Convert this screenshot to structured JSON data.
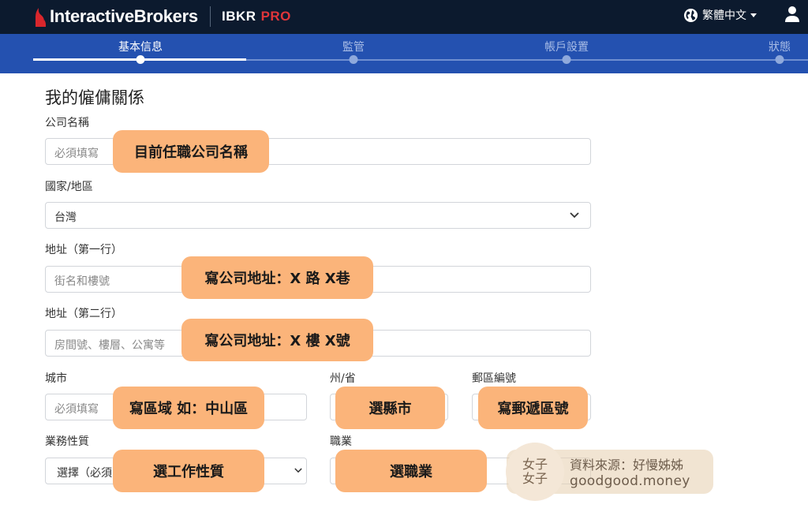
{
  "header": {
    "brand": "InteractiveBrokers",
    "product": "IBKR",
    "product_tag": "PRO",
    "language": "繁體中文",
    "icons": {
      "logo": "flame-icon",
      "language": "globe-icon",
      "language_menu": "caret-down-icon",
      "account": "user-icon"
    }
  },
  "steps": [
    {
      "label": "基本信息",
      "active": true
    },
    {
      "label": "監管",
      "active": false
    },
    {
      "label": "帳戶設置",
      "active": false
    },
    {
      "label": "狀態",
      "active": false
    }
  ],
  "form": {
    "section_title": "我的僱傭關係",
    "company_name": {
      "label": "公司名稱",
      "placeholder": "必須填寫"
    },
    "country": {
      "label": "國家/地區",
      "value": "台灣"
    },
    "address1": {
      "label": "地址（第一行）",
      "placeholder": "街名和樓號"
    },
    "address2": {
      "label": "地址（第二行）",
      "placeholder": "房間號、樓層、公寓等"
    },
    "city": {
      "label": "城市",
      "placeholder": "必須填寫"
    },
    "state": {
      "label": "州/省"
    },
    "postal": {
      "label": "郵區編號"
    },
    "business": {
      "label": "業務性質",
      "value": "選擇（必須"
    },
    "occupation": {
      "label": "職業"
    }
  },
  "callouts": {
    "company": "目前任職公司名稱",
    "address1": "寫公司地址：X 路 X巷",
    "address2": "寫公司地址：X 樓 X號",
    "city": "寫區域 如：中山區",
    "state": "選縣市",
    "postal": "寫郵遞區號",
    "business": "選工作性質",
    "occupation": "選職業"
  },
  "watermark": {
    "logo_top": "女子",
    "logo_bottom": "女子",
    "source": "資料來源：好慢姊姊",
    "site": "goodgood.money"
  },
  "colors": {
    "topbar": "#0c1a2e",
    "stepbar": "#2451b0",
    "callout": "#fbb47a",
    "pro": "#e0353a"
  }
}
